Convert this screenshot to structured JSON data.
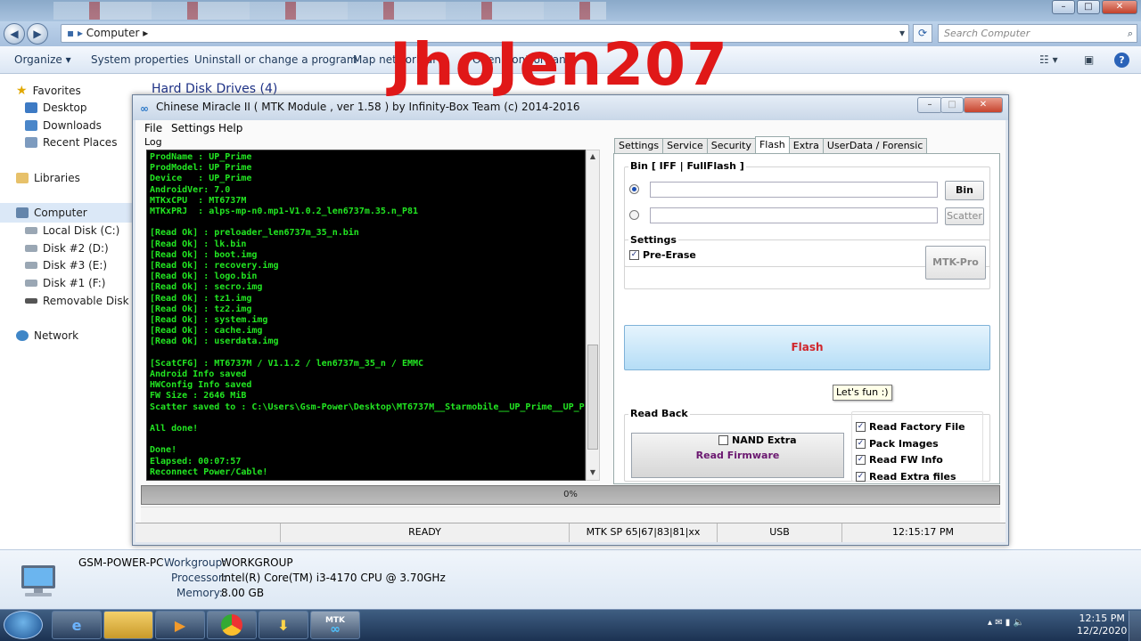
{
  "explorer": {
    "address": "Computer",
    "search_placeholder": "Search Computer",
    "toolbar": [
      "Organize",
      "System properties",
      "Uninstall or change a program",
      "Map network dr",
      "Open Control Pan"
    ],
    "section_title": "Hard Disk Drives (4)",
    "nav": {
      "favorites": "Favorites",
      "desktop": "Desktop",
      "downloads": "Downloads",
      "recent": "Recent Places",
      "libraries": "Libraries",
      "computer": "Computer",
      "drives": [
        "Local Disk (C:)",
        "Disk #2 (D:)",
        "Disk #3 (E:)",
        "Disk #1 (F:)",
        "Removable Disk (H:)"
      ],
      "network": "Network"
    },
    "details": {
      "pc_name": "GSM-POWER-PC",
      "workgroup_label": "Workgroup:",
      "workgroup": "WORKGROUP",
      "processor_label": "Processor:",
      "processor": "Intel(R) Core(TM) i3-4170 CPU @ 3.70GHz",
      "memory_label": "Memory:",
      "memory": "8.00 GB"
    }
  },
  "watermark": "JhoJen207",
  "cm2": {
    "title": "Chinese Miracle II ( MTK Module , ver 1.58 ) by Infinity-Box Team (c) 2014-2016",
    "menu": [
      "File",
      "Settings",
      "Help"
    ],
    "log_label": "Log",
    "log": "ProdName : UP_Prime\nProdModel: UP Prime\nDevice   : UP_Prime\nAndroidVer: 7.0\nMTKxCPU  : MT6737M\nMTKxPRJ  : alps-mp-n0.mp1-V1.0.2_len6737m.35.n_P81\n\n[Read Ok] : preloader_len6737m_35_n.bin\n[Read Ok] : lk.bin\n[Read Ok] : boot.img\n[Read Ok] : recovery.img\n[Read Ok] : logo.bin\n[Read Ok] : secro.img\n[Read Ok] : tz1.img\n[Read Ok] : tz2.img\n[Read Ok] : system.img\n[Read Ok] : cache.img\n[Read Ok] : userdata.img\n\n[ScatCFG] : MT6737M / V1.1.2 / len6737m_35_n / EMMC\nAndroid Info saved\nHWConfig Info saved\nFW Size : 2646 MiB\nScatter saved to : C:\\Users\\Gsm-Power\\Desktop\\MT6737M__Starmobile__UP_Prime__UP_P\n\nAll done!\n\nDone!\nElapsed: 00:07:57\nReconnect Power/Cable!",
    "tabs": [
      "Settings",
      "Service",
      "Security",
      "Flash",
      "Extra",
      "UserData / Forensic"
    ],
    "active_tab": "Flash",
    "flash": {
      "bin_group": "Bin  [ IFF | FullFlash ]",
      "bin_button": "Bin",
      "scatter_button": "Scatter",
      "settings_group": "Settings",
      "pre_erase": "Pre-Erase",
      "mtk_pro": "MTK-Pro",
      "flash_button": "Flash",
      "tooltip": "Let's fun :)",
      "readback_group": "Read Back",
      "read_firmware": "Read Firmware",
      "options": [
        "Read Factory File",
        "Pack Images",
        "Read FW Info",
        "Read Extra files"
      ],
      "nand_extra": "NAND Extra"
    },
    "progress": "0%",
    "status": {
      "state": "READY",
      "platform": "MTK SP 65|67|83|81|xx",
      "port": "USB",
      "time": "12:15:17 PM"
    }
  },
  "taskbar": {
    "time": "12:15 PM",
    "date": "12/2/2020",
    "mtk_label": "MTK"
  }
}
